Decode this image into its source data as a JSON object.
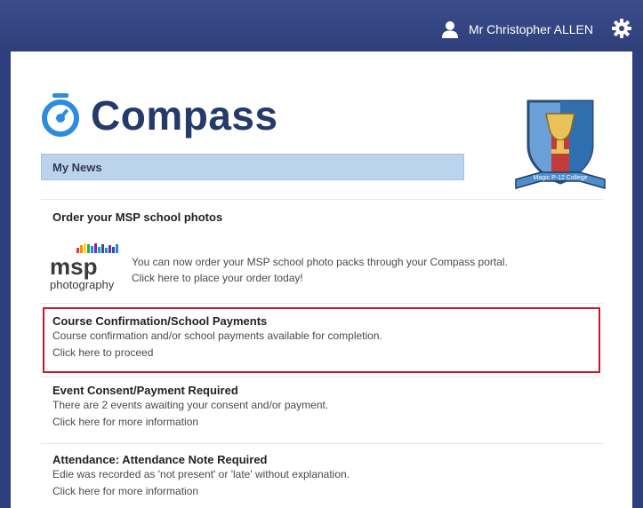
{
  "header": {
    "user_name": "Mr Christopher ALLEN",
    "bg_color": "#2f3f7a"
  },
  "brand": {
    "name": "Compass",
    "color": "#243a6b",
    "accent": "#2d8be0"
  },
  "crest": {
    "caption": "Magic P-12 College"
  },
  "section": {
    "title": "My News"
  },
  "news": [
    {
      "title": "Order your MSP school photos",
      "logo_text": "msp",
      "logo_subtext": "photography",
      "line1": "You can now order your MSP school photo packs through your Compass portal.",
      "link": "Click here to place your order today!"
    },
    {
      "title": "Course Confirmation/School Payments",
      "line1": "Course confirmation and/or school payments available for completion.",
      "link": "Click here to proceed",
      "highlight_color": "#c0192b"
    },
    {
      "title": "Event Consent/Payment Required",
      "line1": "There are 2 events awaiting your consent and/or payment.",
      "link": "Click here for more information"
    },
    {
      "title": "Attendance: Attendance Note Required",
      "line1": "Edie was recorded as 'not present' or 'late' without explanation.",
      "link": "Click here for more information"
    }
  ]
}
